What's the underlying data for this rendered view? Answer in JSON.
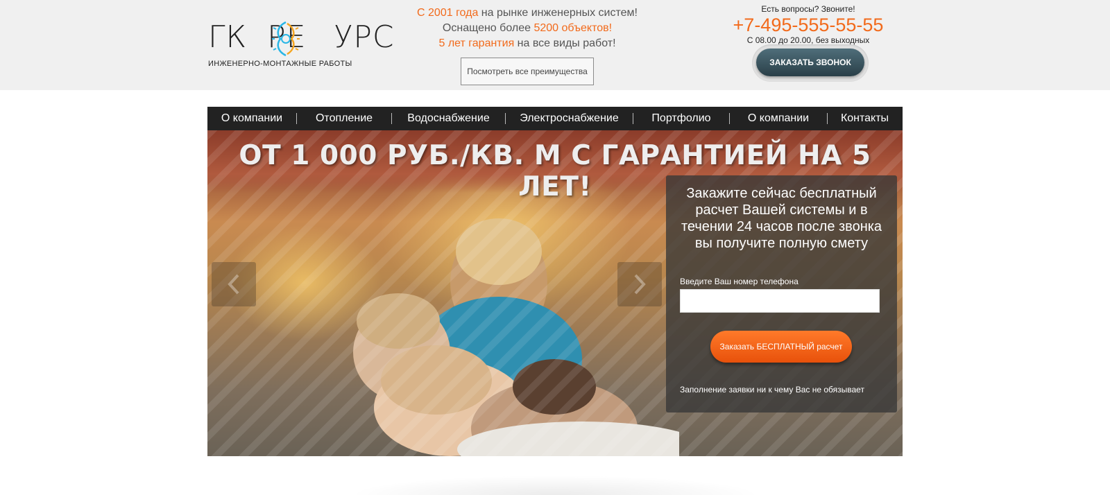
{
  "header": {
    "logo": {
      "part1": "ГК",
      "part2": "РЕ",
      "part3": "УРС",
      "subtitle": "ИНЖЕНЕРНО-МОНТАЖНЫЕ РАБОТЫ"
    },
    "benefits": {
      "line1_accent": "С 2001 года",
      "line1_text": " на рынке инженерных систем!",
      "line2_text": "Оснащено более ",
      "line2_accent": "5200 объектов!",
      "line3_accent": "5 лет гарантия",
      "line3_text": " на все виды работ!",
      "button_label": "Посмотреть все преимущества"
    },
    "contact": {
      "question": "Есть вопросы? Звоните!",
      "phone": "+7-495-555-55-55",
      "hours": "С 08.00 до 20.00, без выходных",
      "call_button": "ЗАКАЗАТЬ ЗВОНОК"
    }
  },
  "nav": {
    "items": [
      {
        "label": "О компании"
      },
      {
        "label": "Отопление"
      },
      {
        "label": "Водоснабжение"
      },
      {
        "label": "Электроснабжение"
      },
      {
        "label": "Портфолио"
      },
      {
        "label": "О компании"
      },
      {
        "label": "Контакты"
      }
    ]
  },
  "hero": {
    "title": "ОТ 1 000 РУБ./КВ. М С ГАРАНТИЕЙ НА 5 ЛЕТ!",
    "form": {
      "title": "Закажите сейчас бесплатный расчет Вашей системы и в течении 24 часов после звонка вы получите полную смету",
      "phone_label": "Введите Ваш номер телефона",
      "phone_value": "",
      "submit_label": "Заказать БЕСПЛАТНЫЙ расчет",
      "note": "Заполнение заявки ни к чему Вас не обязывает"
    },
    "slider": {
      "prev_icon": "chevron-left-icon",
      "next_icon": "chevron-right-icon"
    }
  },
  "colors": {
    "accent": "#f26a1b",
    "nav_bg": "#222222",
    "topbar_bg": "#f0f0f0",
    "call_button": "#3a535e",
    "order_button": "#f4611a",
    "gear_blue": "#29b6e6",
    "gear_orange": "#f5a623"
  }
}
